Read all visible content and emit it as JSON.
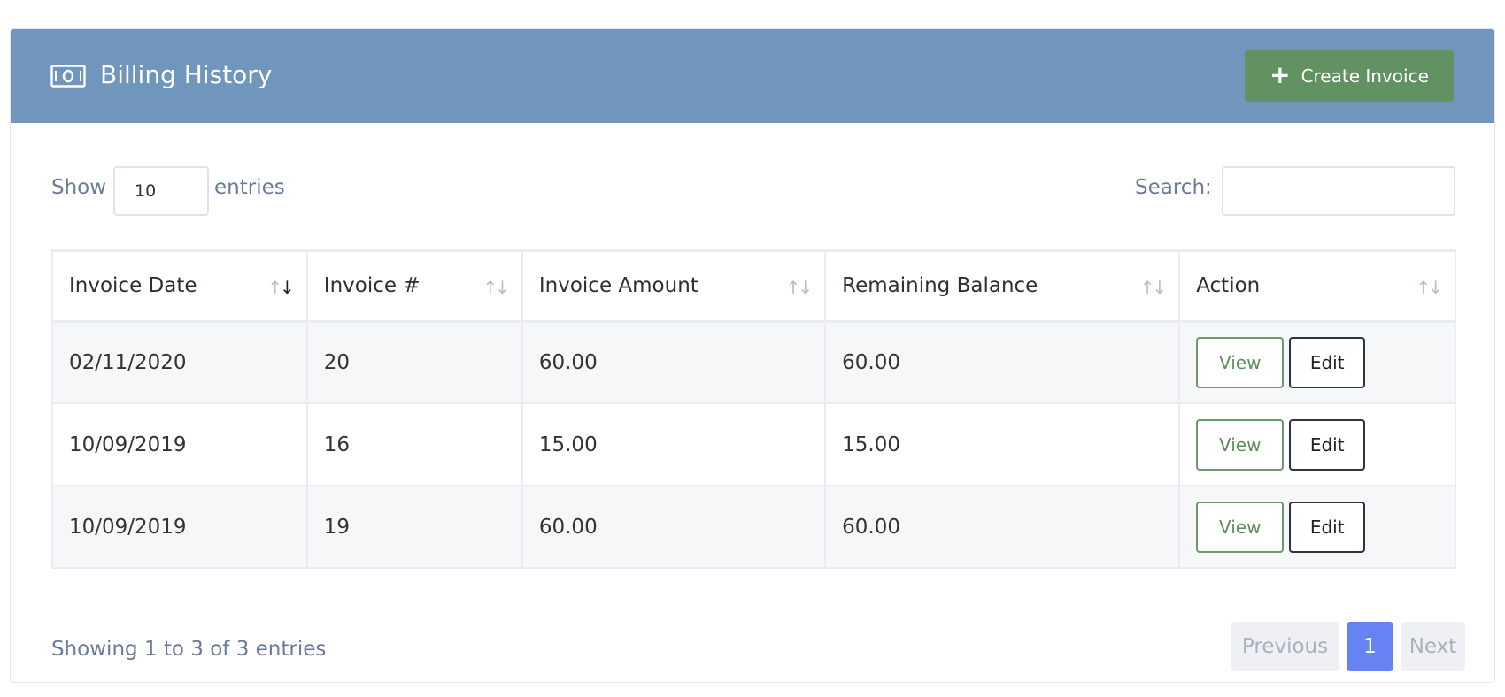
{
  "header": {
    "title": "Billing History",
    "create_button": "Create Invoice"
  },
  "length": {
    "show_label": "Show",
    "value": "10",
    "entries_label": "entries"
  },
  "search": {
    "label": "Search:",
    "value": ""
  },
  "table": {
    "columns": [
      "Invoice Date",
      "Invoice #",
      "Invoice Amount",
      "Remaining Balance",
      "Action"
    ],
    "sorted_column": "Invoice Date",
    "rows": [
      {
        "date": "02/11/2020",
        "number": "20",
        "amount": "60.00",
        "balance": "60.00",
        "view": "View",
        "edit": "Edit"
      },
      {
        "date": "10/09/2019",
        "number": "16",
        "amount": "15.00",
        "balance": "15.00",
        "view": "View",
        "edit": "Edit"
      },
      {
        "date": "10/09/2019",
        "number": "19",
        "amount": "60.00",
        "balance": "60.00",
        "view": "View",
        "edit": "Edit"
      }
    ]
  },
  "footer": {
    "info": "Showing 1 to 3 of 3 entries",
    "previous": "Previous",
    "page": "1",
    "next": "Next"
  },
  "colors": {
    "header_bg": "#7096bd",
    "create_button": "#629162",
    "active_page": "#6683f4"
  }
}
